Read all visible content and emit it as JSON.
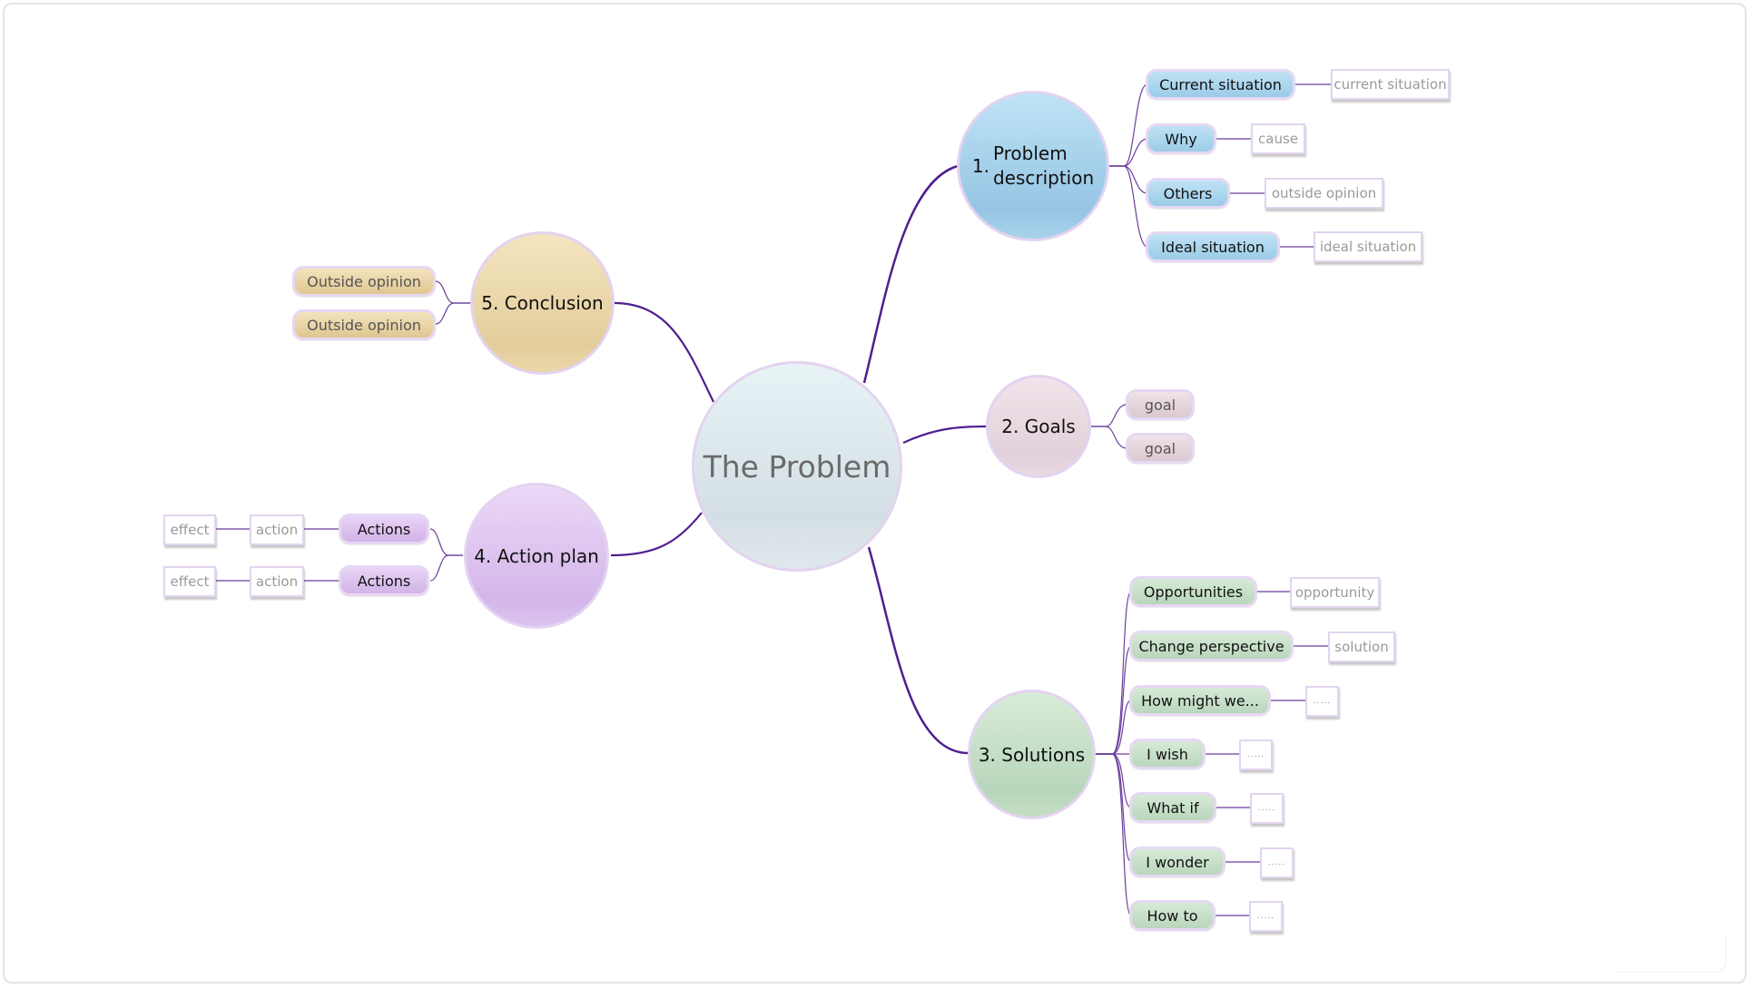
{
  "colors": {
    "branch_line": "#4f1f8f",
    "sub_line": "#7a4fa8",
    "node_border": "#e3d3f0"
  },
  "central": {
    "label": "The Problem"
  },
  "topics": [
    {
      "id": "problem-description",
      "number": "1.",
      "label_line1": "Problem",
      "label_line2": "description",
      "color": "blue",
      "children": [
        {
          "label": "Current situation",
          "detail": "current situation"
        },
        {
          "label": "Why",
          "detail": "cause"
        },
        {
          "label": "Others",
          "detail": "outside opinion"
        },
        {
          "label": "Ideal situation",
          "detail": "ideal situation"
        }
      ]
    },
    {
      "id": "goals",
      "label": "2. Goals",
      "color": "pink",
      "children": [
        {
          "label": "goal"
        },
        {
          "label": "goal"
        }
      ]
    },
    {
      "id": "solutions",
      "label": "3. Solutions",
      "color": "green",
      "children": [
        {
          "label": "Opportunities",
          "detail": "opportunity"
        },
        {
          "label": "Change perspective",
          "detail": "solution"
        },
        {
          "label": "How might we...",
          "detail": "....."
        },
        {
          "label": "I wish",
          "detail": "....."
        },
        {
          "label": "What if",
          "detail": "....."
        },
        {
          "label": "I wonder",
          "detail": "....."
        },
        {
          "label": "How to",
          "detail": "....."
        }
      ]
    },
    {
      "id": "action-plan",
      "label": "4. Action plan",
      "color": "violet",
      "children": [
        {
          "label": "Actions",
          "action": "action",
          "effect": "effect"
        },
        {
          "label": "Actions",
          "action": "action",
          "effect": "effect"
        }
      ]
    },
    {
      "id": "conclusion",
      "label": "5. Conclusion",
      "color": "tan",
      "children": [
        {
          "label": "Outside opinion"
        },
        {
          "label": "Outside opinion"
        }
      ]
    }
  ]
}
